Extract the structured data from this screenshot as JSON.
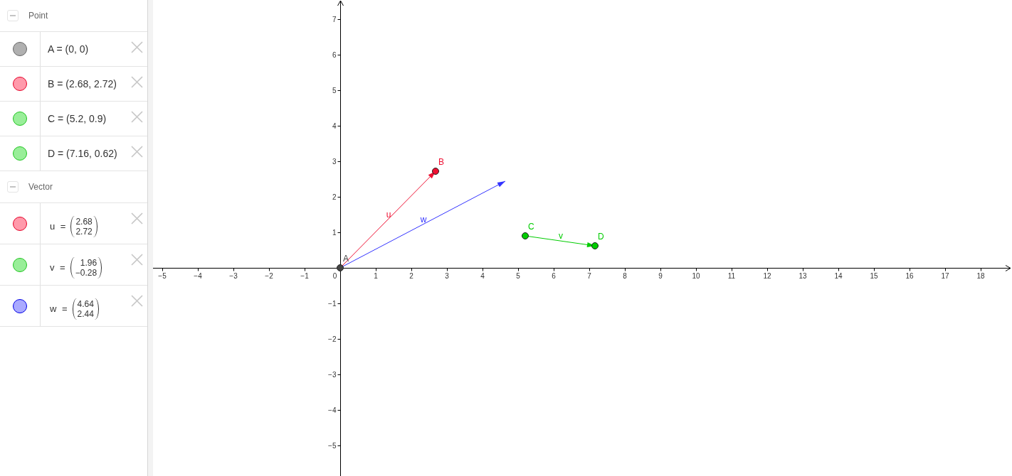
{
  "algebra_view": {
    "groups": [
      {
        "title": "Point",
        "expanded": true,
        "items": [
          {
            "kind": "text",
            "text": "A = (0, 0)",
            "color": "#b0b0b0"
          },
          {
            "kind": "text",
            "text": "B = (2.68, 2.72)",
            "color": "#ff9aab"
          },
          {
            "kind": "text",
            "text": "C = (5.2, 0.9)",
            "color": "#99ee99"
          },
          {
            "kind": "text",
            "text": "D = (7.16, 0.62)",
            "color": "#99ee99"
          }
        ]
      },
      {
        "title": "Vector",
        "expanded": true,
        "items": [
          {
            "kind": "column_vector",
            "label": "u =",
            "components": [
              "2.68",
              "2.72"
            ],
            "color": "#ff9aab"
          },
          {
            "kind": "column_vector",
            "label": "v =",
            "components": [
              "1.96",
              "−0.28"
            ],
            "color": "#99ee99"
          },
          {
            "kind": "column_vector",
            "label": "w =",
            "components": [
              "4.64",
              "2.44"
            ],
            "color": "#aaaaff"
          }
        ]
      }
    ]
  },
  "graphics_view": {
    "chart_data": {
      "type": "scatter",
      "xlim": [
        -5.26,
        18.88
      ],
      "ylim": [
        -5.86,
        7.54
      ],
      "xticks": [
        {
          "value": -5,
          "label": "−5"
        },
        {
          "value": -4,
          "label": "−4"
        },
        {
          "value": -3,
          "label": "−3"
        },
        {
          "value": -2,
          "label": "−2"
        },
        {
          "value": -1,
          "label": "−1"
        },
        0,
        1,
        2,
        3,
        4,
        5,
        6,
        7,
        8,
        9,
        10,
        11,
        12,
        13,
        14,
        15,
        16,
        17,
        18
      ],
      "yticks": [
        {
          "value": -5,
          "label": "−5"
        },
        {
          "value": -4,
          "label": "−4"
        },
        {
          "value": -3,
          "label": "−3"
        },
        {
          "value": -2,
          "label": "−2"
        },
        {
          "value": -1,
          "label": "−1"
        },
        1,
        2,
        3,
        4,
        5,
        6,
        7
      ],
      "series": [
        {
          "name": "u",
          "type": "line",
          "color": "#ee1133",
          "x": [
            0,
            2.68
          ],
          "values": [
            0,
            2.72
          ]
        },
        {
          "name": "w",
          "type": "line",
          "color": "#3333ff",
          "x": [
            0,
            4.64
          ],
          "values": [
            0,
            2.44
          ]
        },
        {
          "name": "v",
          "type": "line",
          "color": "#00cc00",
          "x": [
            5.2,
            7.16
          ],
          "values": [
            0.9,
            0.62
          ]
        },
        {
          "name": "A",
          "color": "#444444",
          "x": [
            0
          ],
          "values": [
            0
          ]
        },
        {
          "name": "B",
          "color": "#ee1133",
          "x": [
            2.68
          ],
          "values": [
            2.72
          ]
        },
        {
          "name": "C",
          "color": "#00cc00",
          "x": [
            5.2
          ],
          "values": [
            0.9
          ]
        },
        {
          "name": "D",
          "color": "#00cc00",
          "x": [
            7.16
          ],
          "values": [
            0.62
          ]
        }
      ]
    }
  }
}
